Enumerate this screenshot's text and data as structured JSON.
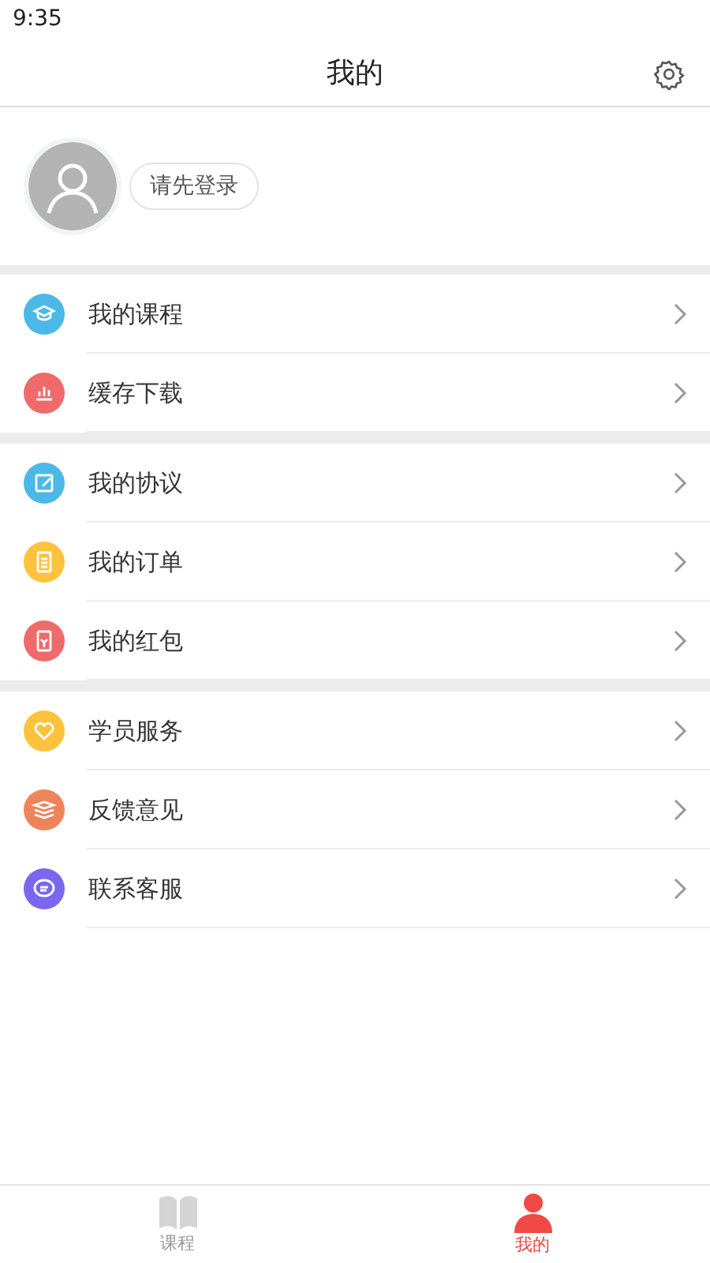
{
  "status_bar": {
    "time": "9:35"
  },
  "header": {
    "title": "我的"
  },
  "profile": {
    "login_button": "请先登录"
  },
  "menu_groups": [
    {
      "items": [
        {
          "label": "我的课程",
          "kind": "cap",
          "color": "#4bb8e8"
        },
        {
          "label": "缓存下载",
          "kind": "chart",
          "color": "#ef6a6a"
        }
      ]
    },
    {
      "items": [
        {
          "label": "我的协议",
          "kind": "edit",
          "color": "#4bb8e8"
        },
        {
          "label": "我的订单",
          "kind": "list",
          "color": "#fdc33d"
        },
        {
          "label": "我的红包",
          "kind": "packet",
          "color": "#ef6a6a"
        }
      ]
    },
    {
      "items": [
        {
          "label": "学员服务",
          "kind": "heart",
          "color": "#fdc33d"
        },
        {
          "label": "反馈意见",
          "kind": "stack",
          "color": "#ee845a"
        },
        {
          "label": "联系客服",
          "kind": "chat",
          "color": "#7a67f0"
        }
      ]
    }
  ],
  "tab_bar": [
    {
      "label": "课程",
      "kind": "book",
      "selected": false
    },
    {
      "label": "我的",
      "kind": "person",
      "selected": true
    }
  ]
}
